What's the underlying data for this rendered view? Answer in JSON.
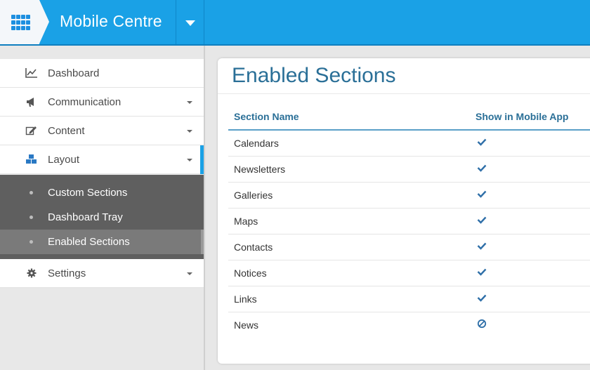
{
  "header": {
    "apps_icon": "grid-icon",
    "title": "Mobile Centre",
    "dropdown_icon": "caret-down-icon",
    "accent_color": "#1aa1e6"
  },
  "sidebar": {
    "items": [
      {
        "label": "Dashboard",
        "icon": "line-chart-icon",
        "has_caret": false
      },
      {
        "label": "Communication",
        "icon": "megaphone-icon",
        "has_caret": true
      },
      {
        "label": "Content",
        "icon": "edit-icon",
        "has_caret": true
      },
      {
        "label": "Layout",
        "icon": "cubes-icon",
        "has_caret": true,
        "active": true
      },
      {
        "label": "Settings",
        "icon": "gear-icon",
        "has_caret": true
      }
    ],
    "layout_submenu": [
      {
        "label": "Custom Sections",
        "active": false
      },
      {
        "label": "Dashboard Tray",
        "active": false
      },
      {
        "label": "Enabled Sections",
        "active": true
      }
    ]
  },
  "main": {
    "title": "Enabled Sections",
    "columns": [
      "Section Name",
      "Show in Mobile App"
    ],
    "rows": [
      {
        "name": "Calendars",
        "shown": true,
        "status_icon": "check-icon"
      },
      {
        "name": "Newsletters",
        "shown": true,
        "status_icon": "check-icon"
      },
      {
        "name": "Galleries",
        "shown": true,
        "status_icon": "check-icon"
      },
      {
        "name": "Maps",
        "shown": true,
        "status_icon": "check-icon"
      },
      {
        "name": "Contacts",
        "shown": true,
        "status_icon": "check-icon"
      },
      {
        "name": "Notices",
        "shown": true,
        "status_icon": "check-icon"
      },
      {
        "name": "Links",
        "shown": true,
        "status_icon": "check-icon"
      },
      {
        "name": "News",
        "shown": false,
        "status_icon": "ban-icon"
      }
    ]
  }
}
